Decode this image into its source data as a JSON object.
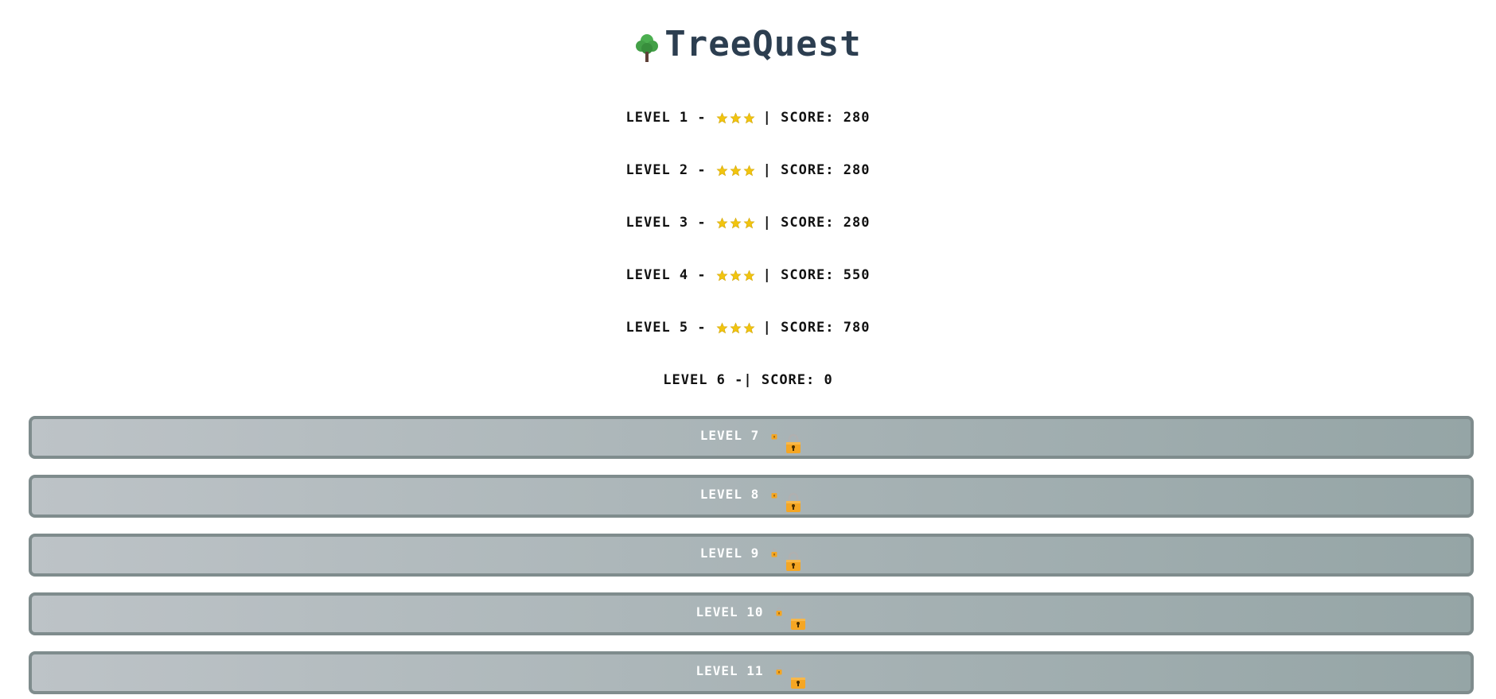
{
  "header": {
    "title": "TreeQuest",
    "icon": "tree-icon"
  },
  "completed_levels": [
    {
      "label": "LEVEL 1 -",
      "stars": 3,
      "score_text": "| SCORE: 280"
    },
    {
      "label": "LEVEL 2 -",
      "stars": 3,
      "score_text": "| SCORE: 280"
    },
    {
      "label": "LEVEL 3 -",
      "stars": 3,
      "score_text": "| SCORE: 280"
    },
    {
      "label": "LEVEL 4 -",
      "stars": 3,
      "score_text": "| SCORE: 550"
    },
    {
      "label": "LEVEL 5 -",
      "stars": 3,
      "score_text": "| SCORE: 780"
    },
    {
      "label": "LEVEL 6 -",
      "stars": 0,
      "score_text": "| SCORE: 0"
    }
  ],
  "locked_levels": [
    {
      "label": "LEVEL 7",
      "icon": "lock-icon"
    },
    {
      "label": "LEVEL 8",
      "icon": "lock-icon"
    },
    {
      "label": "LEVEL 9",
      "icon": "lock-icon"
    },
    {
      "label": "LEVEL 10",
      "icon": "lock-icon"
    },
    {
      "label": "LEVEL 11",
      "icon": "lock-icon"
    }
  ],
  "colors": {
    "title": "#2c3e50",
    "star": "#f1c40f",
    "locked_border": "#7f8c8d",
    "locked_bg_start": "#bdc3c7",
    "locked_bg_end": "#95a5a6",
    "lock_body": "#f5a623"
  }
}
